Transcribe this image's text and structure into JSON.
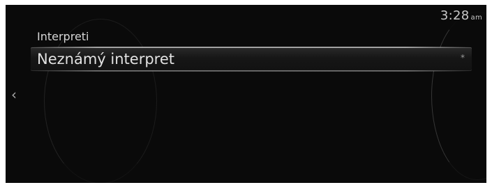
{
  "clock": {
    "time": "3:28",
    "ampm": "am"
  },
  "header": {
    "title": "Interpreti"
  },
  "list": {
    "items": [
      {
        "label": "Neznámý interpret",
        "marker": "*"
      }
    ]
  },
  "navigation": {
    "back_icon": "chevron-left-icon"
  },
  "colors": {
    "background": "#0a0a0a",
    "text": "#e2e2e2"
  }
}
